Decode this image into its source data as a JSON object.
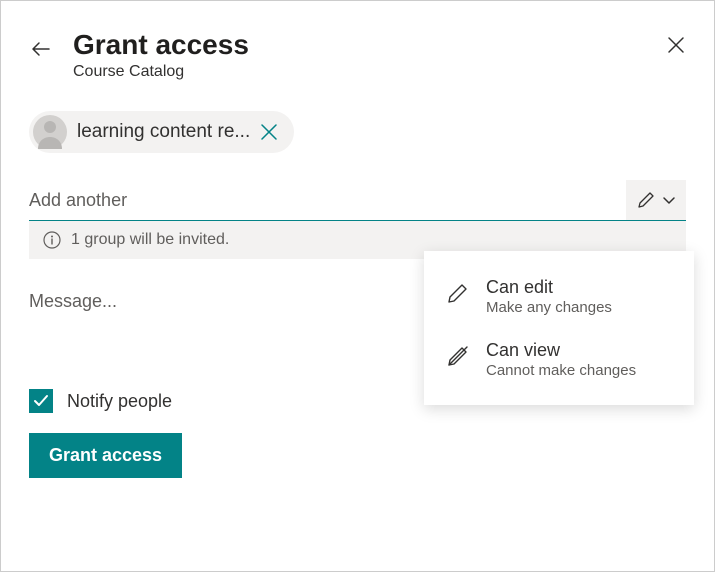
{
  "header": {
    "title": "Grant access",
    "subtitle": "Course Catalog"
  },
  "chip": {
    "name": "learning content re..."
  },
  "addInput": {
    "placeholder": "Add another"
  },
  "infoBar": {
    "text": "1 group will be invited."
  },
  "message": {
    "placeholder": "Message..."
  },
  "notify": {
    "label": "Notify people",
    "checked": true
  },
  "grantButton": {
    "label": "Grant access"
  },
  "dropdown": {
    "options": [
      {
        "title": "Can edit",
        "subtitle": "Make any changes"
      },
      {
        "title": "Can view",
        "subtitle": "Cannot make changes"
      }
    ]
  },
  "colors": {
    "accent": "#038387"
  }
}
